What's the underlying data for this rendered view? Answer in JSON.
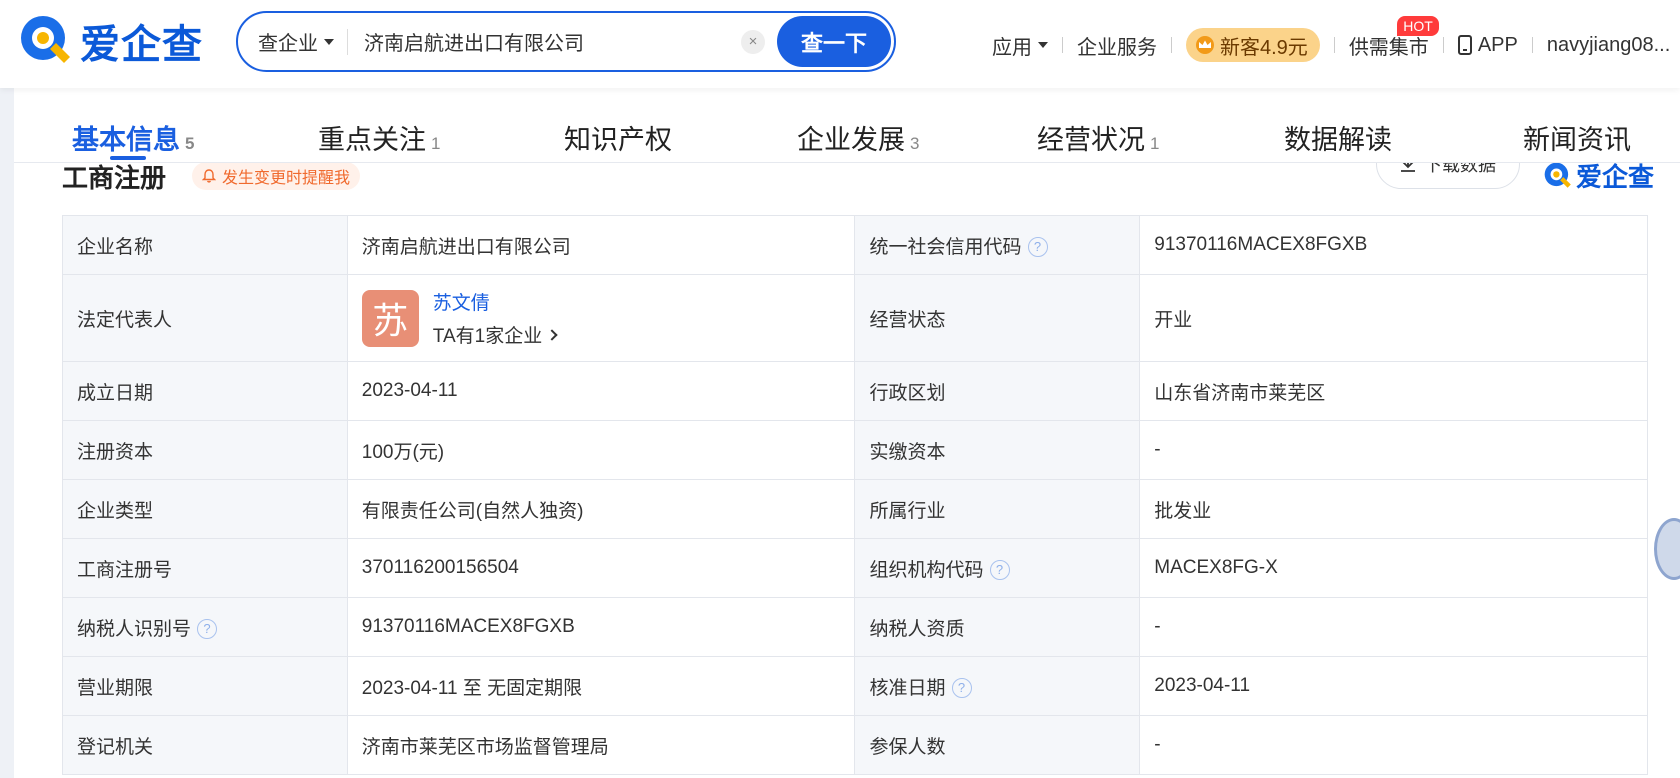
{
  "header": {
    "logo_text": "爱企查",
    "search": {
      "type_label": "查企业",
      "query": "济南启航进出口有限公司",
      "clear_glyph": "×",
      "button_label": "查一下"
    },
    "nav": {
      "apps": "应用",
      "enterprise_service": "企业服务",
      "vip_offer": "新客4.9元",
      "supply_market": "供需集市",
      "hot_badge": "HOT",
      "app": "APP",
      "user": "navyjiang08..."
    }
  },
  "tabs": [
    {
      "label": "基本信息",
      "count": "5"
    },
    {
      "label": "重点关注",
      "count": "1"
    },
    {
      "label": "知识产权",
      "count": ""
    },
    {
      "label": "企业发展",
      "count": "3"
    },
    {
      "label": "经营状况",
      "count": "1"
    },
    {
      "label": "数据解读",
      "count": ""
    },
    {
      "label": "新闻资讯",
      "count": ""
    }
  ],
  "section": {
    "title": "工商注册",
    "remind_label": "发生变更时提醒我",
    "download_label": "下载数据",
    "watermark": "爱企查"
  },
  "registration": {
    "company_name_label": "企业名称",
    "company_name": "济南启航进出口有限公司",
    "credit_code_label": "统一社会信用代码",
    "credit_code": "91370116MACEX8FGXB",
    "legal_rep_label": "法定代表人",
    "legal_rep_avatar": "苏",
    "legal_rep_name": "苏文倩",
    "legal_rep_sub": "TA有1家企业",
    "status_label": "经营状态",
    "status": "开业",
    "founded_label": "成立日期",
    "founded": "2023-04-11",
    "region_label": "行政区划",
    "region": "山东省济南市莱芜区",
    "reg_capital_label": "注册资本",
    "reg_capital": "100万(元)",
    "paid_capital_label": "实缴资本",
    "paid_capital": "-",
    "type_label": "企业类型",
    "type": "有限责任公司(自然人独资)",
    "industry_label": "所属行业",
    "industry": "批发业",
    "reg_no_label": "工商注册号",
    "reg_no": "370116200156504",
    "org_code_label": "组织机构代码",
    "org_code": "MACEX8FG-X",
    "taxpayer_id_label": "纳税人识别号",
    "taxpayer_id": "91370116MACEX8FGXB",
    "taxpayer_qual_label": "纳税人资质",
    "taxpayer_qual": "-",
    "term_label": "营业期限",
    "term": "2023-04-11 至 无固定期限",
    "approval_date_label": "核准日期",
    "approval_date": "2023-04-11",
    "authority_label": "登记机关",
    "authority": "济南市莱芜区市场监督管理局",
    "insured_label": "参保人数",
    "insured": "-"
  },
  "colors": {
    "brand_blue": "#1a5fe0",
    "avatar_bg": "#e88f76",
    "remind_orange": "#f06a2e",
    "vip_gold": "#fbd38a"
  }
}
